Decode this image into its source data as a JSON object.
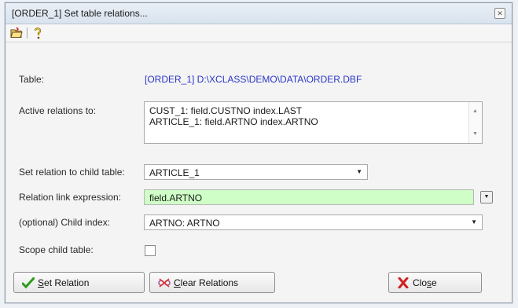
{
  "window": {
    "title": "[ORDER_1] Set table relations..."
  },
  "toolbar": {
    "items": [
      {
        "icon": "folder-open-icon"
      },
      {
        "icon": "help-icon"
      }
    ]
  },
  "form": {
    "table_label": "Table:",
    "table_value": "[ORDER_1] D:\\XCLASS\\DEMO\\DATA\\ORDER.DBF",
    "active_relations_label": "Active relations to:",
    "active_relations": [
      "CUST_1: field.CUSTNO index.LAST",
      "ARTICLE_1: field.ARTNO index.ARTNO"
    ],
    "child_table_label": "Set relation to child table:",
    "child_table_value": "ARTICLE_1",
    "link_expression_label": "Relation link expression:",
    "link_expression_value": "field.ARTNO",
    "child_index_label": "(optional) Child index:",
    "child_index_value": "ARTNO: ARTNO",
    "scope_label": "Scope child table:",
    "scope_checked": false
  },
  "buttons": {
    "set_relation": {
      "accel": "S",
      "rest": "et Relation"
    },
    "clear_relations": {
      "accel": "C",
      "rest": "lear Relations"
    },
    "close": {
      "pre": "Clo",
      "accel": "s",
      "post": "e"
    }
  },
  "colors": {
    "path_text": "#2a35c9",
    "expression_bg": "#cfffc6"
  }
}
